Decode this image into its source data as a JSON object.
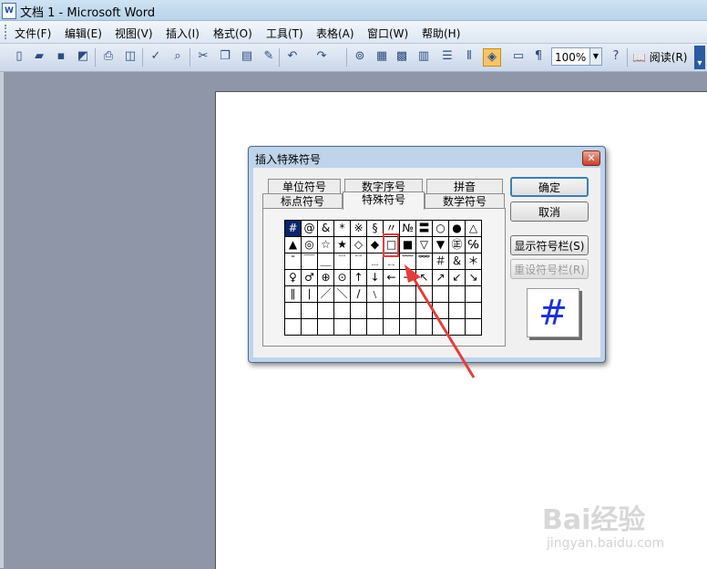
{
  "window": {
    "title": "文档 1 - Microsoft Word",
    "app_icon": "W"
  },
  "menu": [
    "文件(F)",
    "编辑(E)",
    "视图(V)",
    "插入(I)",
    "格式(O)",
    "工具(T)",
    "表格(A)",
    "窗口(W)",
    "帮助(H)"
  ],
  "toolbar": {
    "zoom": "100%",
    "read_label": "阅读(R)"
  },
  "dialog": {
    "title": "插入特殊符号",
    "close": "✕",
    "tabs_back": [
      "单位符号",
      "数字序号",
      "拼音"
    ],
    "tabs_front": [
      "标点符号",
      "特殊符号",
      "数学符号"
    ],
    "active_tab": "特殊符号",
    "symbols": [
      [
        "#",
        "@",
        "&",
        "*",
        "※",
        "§",
        "〃",
        "№",
        "〓",
        "○",
        "●",
        "△"
      ],
      [
        "▲",
        "◎",
        "☆",
        "★",
        "◇",
        "◆",
        "□",
        "■",
        "▽",
        "▼",
        "㊣",
        "℅"
      ],
      [
        "ˉ",
        "￣",
        "＿",
        "﹉",
        "﹊",
        "﹍",
        "﹎",
        "﹋",
        "﹌",
        "＃",
        "＆",
        "＊"
      ],
      [
        "♀",
        "♂",
        "⊕",
        "⊙",
        "↑",
        "↓",
        "←",
        "→",
        "↖",
        "↗",
        "↙",
        "↘"
      ],
      [
        "∥",
        "∣",
        "／",
        "＼",
        "∕",
        "﹨",
        "",
        "",
        "",
        "",
        "",
        ""
      ],
      [
        "",
        "",
        "",
        "",
        "",
        "",
        "",
        "",
        "",
        "",
        "",
        ""
      ],
      [
        "",
        "",
        "",
        "",
        "",
        "",
        "",
        "",
        "",
        "",
        "",
        ""
      ]
    ],
    "selected_symbol": "#",
    "ok_label": "确定",
    "cancel_label": "取消",
    "show_bar_label": "显示符号栏(S)",
    "reset_bar_label": "重设符号栏(R)",
    "preview_symbol": "#"
  },
  "watermark": {
    "logo": "Bai经验",
    "url": "jingyan.baidu.com"
  },
  "colors": {
    "highlight": "#e53d3d",
    "preview_symbol": "#1a2fd6",
    "selected_cell": "#0a246a"
  }
}
